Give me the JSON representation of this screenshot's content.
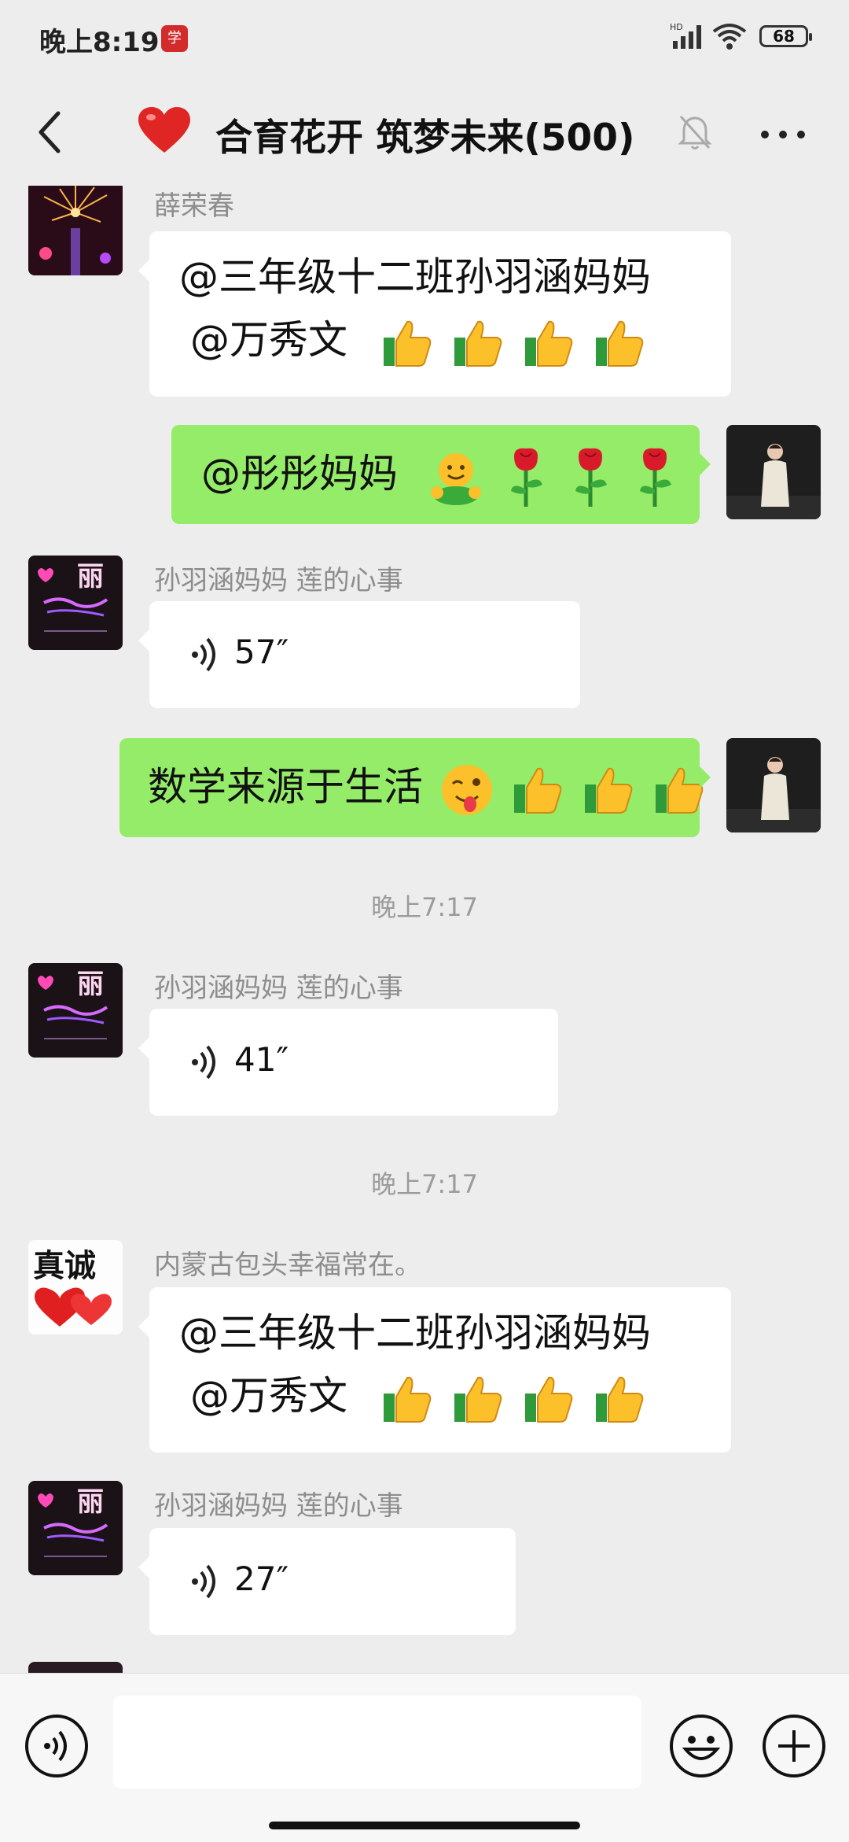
{
  "status_bar": {
    "time": "晚上8:19",
    "app_badge": "学",
    "battery": "68",
    "hd": "HD"
  },
  "header": {
    "title": "合育花开 筑梦未来(500)"
  },
  "messages": [
    {
      "sender": "薛荣春",
      "line1": "@三年级十二班孙羽涵妈妈",
      "line2": "@万秀文"
    },
    {
      "text": "@彤彤妈妈"
    },
    {
      "sender": "孙羽涵妈妈  莲的心事",
      "duration": "57″"
    },
    {
      "text": "数学来源于生活"
    },
    {
      "sender": "孙羽涵妈妈  莲的心事",
      "duration": "41″"
    },
    {
      "sender": "内蒙古包头幸福常在。",
      "line1": "@三年级十二班孙羽涵妈妈",
      "line2": "@万秀文"
    },
    {
      "sender": "孙羽涵妈妈  莲的心事",
      "duration": "27″"
    }
  ],
  "timestamps": [
    "晚上7:17",
    "晚上7:17"
  ],
  "avatars": {
    "zhencheng_text": "真诚",
    "li_text": "丽"
  },
  "colors": {
    "background": "#ededed",
    "green_bubble": "#95ec69",
    "white_bubble": "#ffffff",
    "accent_heart": "#e02525"
  }
}
